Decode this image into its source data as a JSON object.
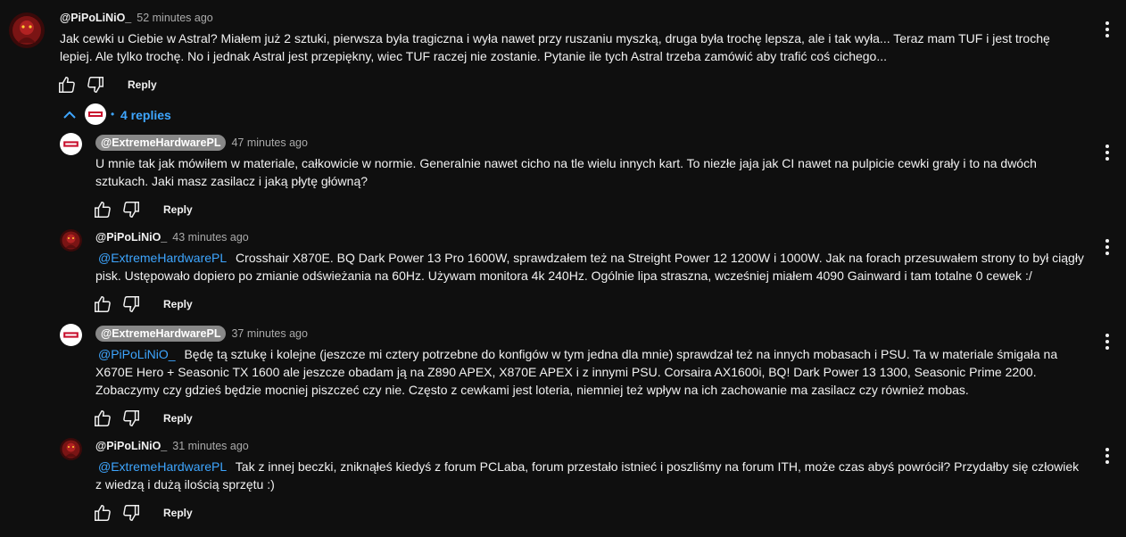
{
  "top_comment": {
    "author": "@PiPoLiNiO_",
    "time": "52 minutes ago",
    "text": "Jak cewki u Ciebie w Astral? Miałem już 2 sztuki, pierwsza była tragiczna i wyła nawet przy ruszaniu myszką, druga była trochę lepsza, ale i tak wyła... Teraz mam TUF i jest trochę lepiej. Ale tylko trochę. No i jednak Astral jest przepiękny, wiec TUF raczej nie zostanie. Pytanie ile tych Astral trzeba zamówić aby trafić coś cichego...",
    "reply_label": "Reply"
  },
  "replies_toggle": {
    "dot": "•",
    "label": "4 replies"
  },
  "replies": [
    {
      "author": "@ExtremeHardwarePL",
      "time": "47 minutes ago",
      "mention": "",
      "text": "U mnie tak jak mówiłem w materiale, całkowicie w normie. Generalnie nawet cicho na tle wielu innych kart. To niezłe jaja jak CI nawet na pulpicie cewki grały i to na dwóch sztukach. Jaki masz zasilacz i jaką płytę główną?",
      "reply_label": "Reply"
    },
    {
      "author": "@PiPoLiNiO_",
      "time": "43 minutes ago",
      "mention": "@ExtremeHardwarePL",
      "text": " Crosshair X870E. BQ Dark Power 13 Pro 1600W, sprawdzałem też na Streight Power 12 1200W i 1000W.  Jak na forach przesuwałem strony to był ciągły pisk. Ustępowało dopiero po zmianie odświeżania na 60Hz. Używam monitora 4k 240Hz. Ogólnie lipa straszna, wcześniej miałem 4090 Gainward i tam totalne 0 cewek :/",
      "reply_label": "Reply"
    },
    {
      "author": "@ExtremeHardwarePL",
      "time": "37 minutes ago",
      "mention": "@PiPoLiNiO_",
      "text": " Będę tą sztukę i kolejne (jeszcze mi cztery potrzebne do konfigów w tym jedna dla mnie) sprawdzał też na innych mobasach i PSU. Ta w materiale śmigała na X670E Hero + Seasonic TX 1600 ale jeszcze obadam ją na Z890 APEX, X870E APEX i z innymi PSU. Corsaira AX1600i, BQ! Dark Power 13 1300, Seasonic Prime 2200. Zobaczymy czy gdzieś będzie mocniej piszczeć czy nie. Często z cewkami jest loteria, niemniej też wpływ na ich zachowanie ma zasilacz czy również mobas.",
      "reply_label": "Reply"
    },
    {
      "author": "@PiPoLiNiO_",
      "time": "31 minutes ago",
      "mention": "@ExtremeHardwarePL",
      "text": " Tak z innej beczki, zniknąłeś kiedyś z forum PCLaba, forum przestało istnieć i poszliśmy na forum ITH, może czas abyś powrócił? Przydałby się człowiek z wiedzą i dużą ilością sprzętu :)",
      "reply_label": "Reply"
    }
  ],
  "icons": {
    "like": "thumbs-up-icon",
    "dislike": "thumbs-down-icon",
    "more": "vertical-dots-icon",
    "collapse": "chevron-up-icon"
  },
  "colors": {
    "background": "#0f0f0f",
    "text": "#f1f1f1",
    "secondary_text": "#aaaaaa",
    "link": "#3ea6ff",
    "creator_chip": "#888888"
  }
}
